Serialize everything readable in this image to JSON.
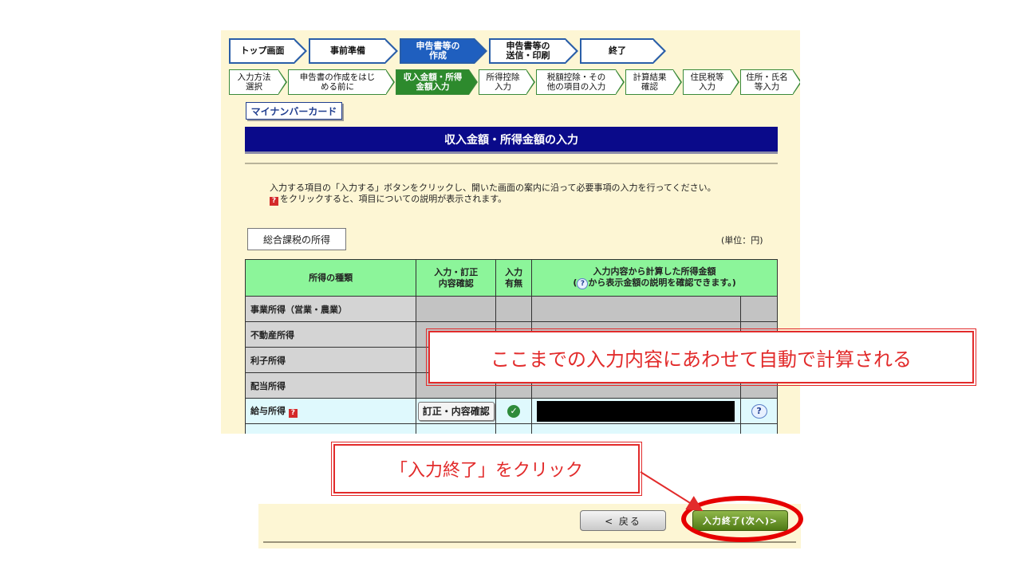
{
  "steps_main": [
    {
      "label": "トップ画面",
      "active": false
    },
    {
      "label": "事前準備",
      "active": false
    },
    {
      "label": "申告書等の\n作成",
      "active": true
    },
    {
      "label": "申告書等の\n送信・印刷",
      "active": false
    },
    {
      "label": "終了",
      "active": false
    }
  ],
  "steps_sub": [
    {
      "label": "入力方法\n選択",
      "active": false
    },
    {
      "label": "申告書の作成をはじ\nめる前に",
      "active": false
    },
    {
      "label": "収入金額・所得\n金額入力",
      "active": true
    },
    {
      "label": "所得控除\n入力",
      "active": false
    },
    {
      "label": "税額控除・その\n他の項目の入力",
      "active": false
    },
    {
      "label": "計算結果\n確認",
      "active": false
    },
    {
      "label": "住民税等\n入力",
      "active": false
    },
    {
      "label": "住所・氏名\n等入力",
      "active": false
    }
  ],
  "mynumber_label": "マイナンバーカード",
  "page_title": "収入金額・所得金額の入力",
  "instruction_line1": "入力する項目の「入力する」ボタンをクリックし、開いた画面の案内に沿って必要事項の入力を行ってください。",
  "instruction_line2": "をクリックすると、項目についての説明が表示されます。",
  "help_icon_glyph": "?",
  "section_title": "総合課税の所得",
  "unit_label": "(単位：円)",
  "table": {
    "headers": {
      "type": "所得の種類",
      "edit": "入力・訂正\n内容確認",
      "status": "入力\n有無",
      "amount_line1": "入力内容から計算した所得金額",
      "amount_line2_pre": "(",
      "amount_line2_post": "から表示金額の説明を確認できます。)"
    },
    "rows": [
      {
        "name": "事業所得（営業・農業）"
      },
      {
        "name": "不動産所得"
      },
      {
        "name": "利子所得"
      },
      {
        "name": "配当所得"
      },
      {
        "name": "給与所得",
        "edit_label": "訂正・内容確認",
        "has_input": true
      }
    ]
  },
  "callout_auto_calc": "ここまでの入力内容にあわせて自動で計算される",
  "callout_click": "「入力終了」をクリック",
  "buttons": {
    "back": "< 戻る",
    "next": "入力終了(次へ)>"
  },
  "colors": {
    "title_bar": "#0a0a8a",
    "header_green": "#8cf59a",
    "annotation_red": "#e22b2b"
  }
}
